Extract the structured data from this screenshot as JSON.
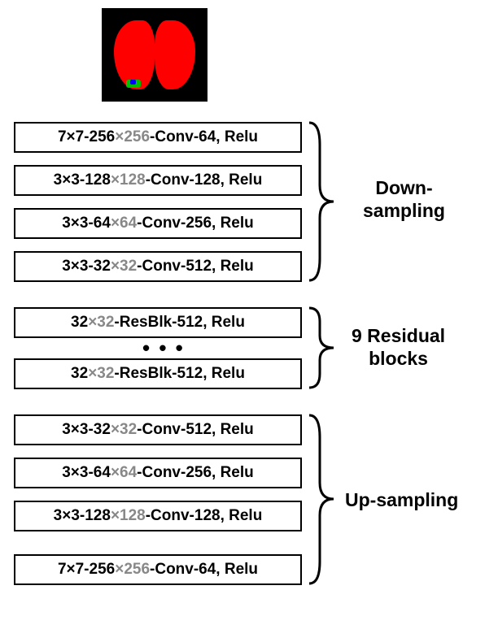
{
  "downsampling": {
    "layers": [
      {
        "prefix": "7×7-256",
        "gray": "×256",
        "suffix": "-Conv-64, Relu"
      },
      {
        "prefix": "3×3-128",
        "gray": "×128",
        "suffix": "-Conv-128, Relu"
      },
      {
        "prefix": "3×3-64",
        "gray": "×64",
        "suffix": "-Conv-256, Relu"
      },
      {
        "prefix": "3×3-32",
        "gray": "×32",
        "suffix": "-Conv-512, Relu"
      }
    ],
    "label_line1": "Down-",
    "label_line2": "sampling"
  },
  "residual": {
    "layers": [
      {
        "prefix": "32",
        "gray": "×32",
        "suffix": "-ResBlk-512, Relu"
      },
      {
        "prefix": "32",
        "gray": "×32",
        "suffix": "-ResBlk-512, Relu"
      }
    ],
    "ellipsis": "• • •",
    "label_line1": "9 Residual",
    "label_line2": "blocks"
  },
  "upsampling": {
    "layers": [
      {
        "prefix": "3×3-32",
        "gray": "×32",
        "suffix": "-Conv-512, Relu"
      },
      {
        "prefix": "3×3-64",
        "gray": "×64",
        "suffix": "-Conv-256, Relu"
      },
      {
        "prefix": "3×3-128",
        "gray": "×128",
        "suffix": "-Conv-128, Relu"
      },
      {
        "prefix": "7×7-256",
        "gray": "×256",
        "suffix": "-Conv-64, Relu"
      }
    ],
    "label": "Up-sampling"
  }
}
